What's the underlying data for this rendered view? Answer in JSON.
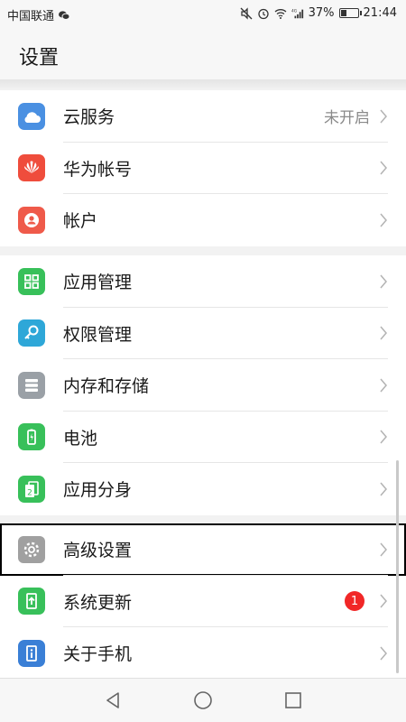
{
  "status_bar": {
    "carrier": "中国联通",
    "battery_percent": "37%",
    "battery_level": 0.37,
    "time": "21:44",
    "network": "4G"
  },
  "header": {
    "title": "设置"
  },
  "groups": [
    {
      "items": [
        {
          "label": "云服务",
          "value": "未开启",
          "icon": "cloud-icon",
          "icon_color": "#4a90e2"
        },
        {
          "label": "华为帐号",
          "icon": "huawei-logo-icon",
          "icon_color": "#ef4d3c"
        },
        {
          "label": "帐户",
          "icon": "account-icon",
          "icon_color": "#ef5a4a"
        }
      ]
    },
    {
      "items": [
        {
          "label": "应用管理",
          "icon": "apps-grid-icon",
          "icon_color": "#38c05a"
        },
        {
          "label": "权限管理",
          "icon": "key-icon",
          "icon_color": "#2ea7d8"
        },
        {
          "label": "内存和存储",
          "icon": "storage-icon",
          "icon_color": "#9aa0a6"
        },
        {
          "label": "电池",
          "icon": "battery-icon",
          "icon_color": "#38c05a"
        },
        {
          "label": "应用分身",
          "icon": "app-twin-icon",
          "icon_color": "#38c05a"
        }
      ]
    },
    {
      "items": [
        {
          "label": "高级设置",
          "icon": "gear-icon",
          "icon_color": "#a0a0a0"
        },
        {
          "label": "系统更新",
          "badge": "1",
          "icon": "system-update-icon",
          "icon_color": "#38c05a"
        },
        {
          "label": "关于手机",
          "icon": "info-icon",
          "icon_color": "#3a7fd6"
        }
      ]
    }
  ],
  "nav": {
    "back": "back-icon",
    "home": "home-icon",
    "recents": "recents-icon"
  }
}
